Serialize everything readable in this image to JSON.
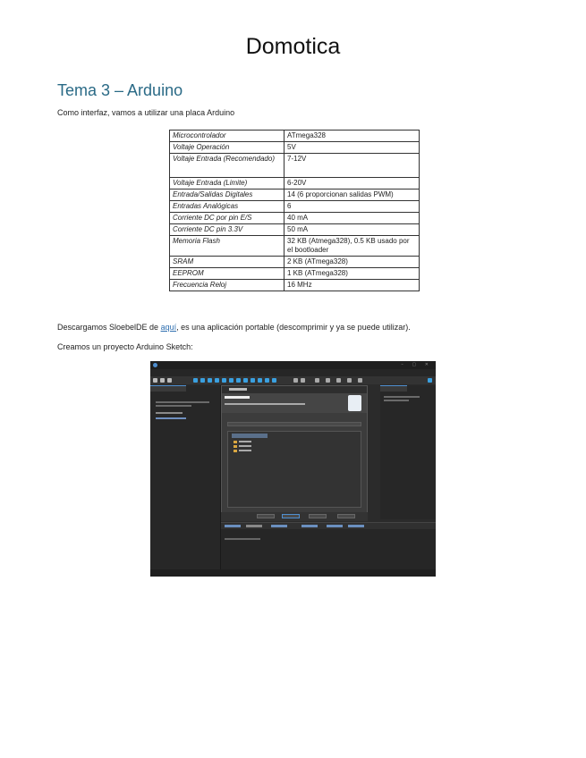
{
  "document": {
    "title": "Domotica",
    "section_heading": "Tema 3 – Arduino",
    "intro": "Como interfaz, vamos a utilizar una placa Arduino",
    "download_prefix": "Descargamos SloebelDE de ",
    "download_link": "aquí",
    "download_suffix": ", es una aplicación portable (descomprimir y ya se puede utilizar).",
    "create_project": "Creamos un proyecto Arduino Sketch:"
  },
  "specs": [
    {
      "label": "Microcontrolador",
      "value": "ATmega328"
    },
    {
      "label": "Voltaje Operación",
      "value": "5V"
    },
    {
      "label": "Voltaje Entrada (Recomendado)",
      "value": "7-12V"
    },
    {
      "label": "Voltaje Entrada (Limite)",
      "value": "6-20V"
    },
    {
      "label": "Entrada/Salidas Digitales",
      "value": "14 (6 proporcionan salidas PWM)"
    },
    {
      "label": "Entradas Analógicas",
      "value": "6"
    },
    {
      "label": "Corriente DC por pin E/S",
      "value": "40 mA"
    },
    {
      "label": "Corriente DC pin 3.3V",
      "value": "50 mA"
    },
    {
      "label": "Memoria Flash",
      "value": "32 KB (Atmega328), 0.5 KB usado por el bootloader"
    },
    {
      "label": "SRAM",
      "value": "2 KB (ATmega328)"
    },
    {
      "label": "EEPROM",
      "value": "1 KB (ATmega328)"
    },
    {
      "label": "Frecuencia Reloj",
      "value": "16 MHz"
    }
  ]
}
